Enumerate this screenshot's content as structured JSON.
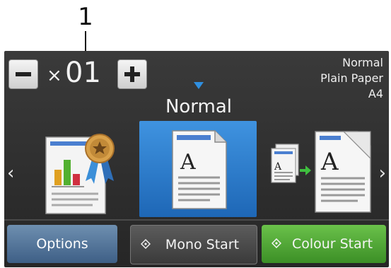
{
  "callout": {
    "number": "1"
  },
  "copies": {
    "prefix": "×",
    "value": "01"
  },
  "settings": {
    "quality": "Normal",
    "paper_type": "Plain Paper",
    "paper_size": "A4"
  },
  "mode": {
    "label": "Normal"
  },
  "buttons": {
    "options": "Options",
    "mono_start": "Mono Start",
    "colour_start": "Colour Start"
  },
  "nav": {
    "left": "‹",
    "right": "›"
  },
  "colors": {
    "accent": "#2f8fe0",
    "colour_start": "#4caa30",
    "options": "#4f729c"
  }
}
